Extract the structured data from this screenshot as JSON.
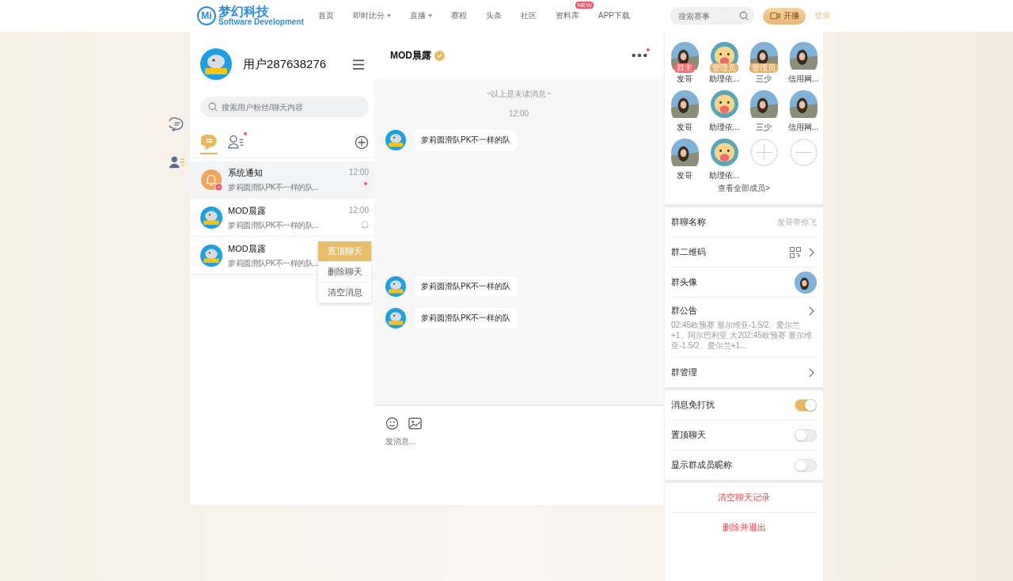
{
  "nav": {
    "logo": {
      "mark": "Mi",
      "name": "梦幻科技",
      "tagline": "Software Development"
    },
    "items": [
      {
        "label": "首页",
        "dropdown": false
      },
      {
        "label": "即时比分",
        "dropdown": true
      },
      {
        "label": "直播",
        "dropdown": true
      },
      {
        "label": "赛程",
        "dropdown": false
      },
      {
        "label": "头条",
        "dropdown": false
      },
      {
        "label": "社区",
        "dropdown": false
      },
      {
        "label": "资料库",
        "dropdown": false,
        "badge": "NEW"
      },
      {
        "label": "APP下载",
        "dropdown": false
      }
    ],
    "search": {
      "placeholder": "搜索赛事"
    },
    "live_button": "开播",
    "login": "登录"
  },
  "profile": {
    "name": "用户287638276"
  },
  "sidebar_search": {
    "placeholder": "搜索用户粉丝/聊天内容"
  },
  "tabs": [
    {
      "kind": "chats",
      "selected": true,
      "dot": false
    },
    {
      "kind": "contacts",
      "selected": false,
      "dot": true
    }
  ],
  "conversations": [
    {
      "kind": "system",
      "name": "系统通知",
      "preview": "萝莉圆滑队PK不一样的队...",
      "time": "12:00",
      "selected": true,
      "unread": true,
      "muted": false
    },
    {
      "kind": "user",
      "name": "MOD晨露",
      "preview": "萝莉圆滑队PK不一样的队...",
      "time": "12:00",
      "selected": false,
      "unread": false,
      "muted": true
    },
    {
      "kind": "user",
      "name": "MOD晨露",
      "preview": "萝莉圆滑队PK不一样的队...",
      "selected": false
    }
  ],
  "context_menu": [
    {
      "label": "置顶聊天",
      "selected": true
    },
    {
      "label": "删除聊天",
      "selected": false
    },
    {
      "label": "清空消息",
      "selected": false
    }
  ],
  "chat": {
    "title": "MOD晨露",
    "verified": true,
    "more_dot": true,
    "messages": [
      {
        "kind": "divider",
        "text": "~以上是未读消息~"
      },
      {
        "kind": "time",
        "text": "12:00"
      },
      {
        "kind": "message",
        "text": "萝莉圆滑队PK不一样的队"
      },
      {
        "kind": "message",
        "text": "萝莉圆滑队PK不一样的队"
      },
      {
        "kind": "message",
        "text": "萝莉圆滑队PK不一样的队"
      }
    ],
    "composer": {
      "placeholder": "发消息..."
    }
  },
  "members": [
    {
      "name": "发哥",
      "kind": "photo",
      "role": "群主",
      "color": "#f0666a"
    },
    {
      "name": "助理依...",
      "kind": "cartoon",
      "role": "管理员",
      "color": "#e6b06a"
    },
    {
      "name": "三少",
      "kind": "photo",
      "role": "管理员",
      "color": "#e6b06a"
    },
    {
      "name": "信用网...",
      "kind": "photo"
    },
    {
      "name": "发哥",
      "kind": "photo"
    },
    {
      "name": "助理依...",
      "kind": "cartoon"
    },
    {
      "name": "三少",
      "kind": "photo"
    },
    {
      "name": "信用网...",
      "kind": "photo"
    },
    {
      "name": "发哥",
      "kind": "photo"
    },
    {
      "name": "助理依...",
      "kind": "cartoon"
    }
  ],
  "view_all_members": "查看全部成员>",
  "group_info": [
    {
      "kind": "text",
      "label": "群聊名称",
      "value": "发哥带你飞"
    },
    {
      "kind": "qr",
      "label": "群二维码"
    },
    {
      "kind": "avatar",
      "label": "群头像"
    },
    {
      "kind": "notice",
      "label": "群公告",
      "text": "02:45欧预赛 塞尔维亚-1.5/2、爱尔兰+1、阿尔巴利亚 大202:45欧预赛 塞尔维亚-1.5/2、爱尔兰+1..."
    },
    {
      "kind": "link",
      "label": "群管理"
    }
  ],
  "toggles": [
    {
      "label": "消息免打扰",
      "on": true
    },
    {
      "label": "置顶聊天",
      "on": false
    },
    {
      "label": "显示群成员昵称",
      "on": false
    }
  ],
  "actions": [
    "清空聊天记录",
    "删除并退出"
  ]
}
